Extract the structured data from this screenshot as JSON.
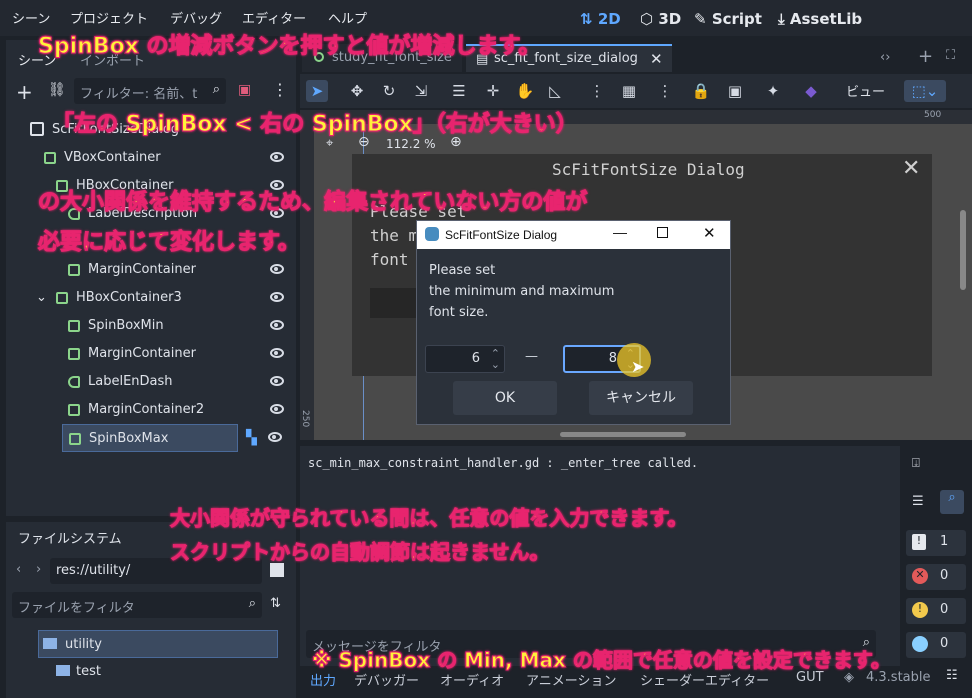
{
  "menu": [
    "シーン",
    "プロジェクト",
    "デバッグ",
    "エディター",
    "ヘルプ"
  ],
  "workspace": [
    {
      "label": "2D",
      "active": true
    },
    {
      "label": "3D"
    },
    {
      "label": "Script"
    },
    {
      "label": "AssetLib"
    }
  ],
  "scene_dock": {
    "tabs": [
      "シーン",
      "インポート"
    ],
    "filter_placeholder": "フィルター: 名前、t",
    "tree": [
      {
        "name": "ScFitFontSizeDialog",
        "indent": 0,
        "icon": "panel"
      },
      {
        "name": "VBoxContainer",
        "indent": 1,
        "icon": "vbox"
      },
      {
        "name": "HBoxContainer",
        "indent": 2,
        "icon": "hbox"
      },
      {
        "name": "LabelDescription",
        "indent": 3,
        "icon": "label"
      },
      {
        "name": "MarginContainer",
        "indent": 2,
        "icon": "margin"
      },
      {
        "name": "HBoxContainer3",
        "indent": 2,
        "icon": "hbox"
      },
      {
        "name": "SpinBoxMin",
        "indent": 3,
        "icon": "spin"
      },
      {
        "name": "MarginContainer",
        "indent": 3,
        "icon": "margin"
      },
      {
        "name": "LabelEnDash",
        "indent": 3,
        "icon": "label"
      },
      {
        "name": "MarginContainer2",
        "indent": 3,
        "icon": "margin"
      },
      {
        "name": "SpinBoxMax",
        "indent": 3,
        "icon": "spin",
        "selected": true
      }
    ]
  },
  "filesystem": {
    "title": "ファイルシステム",
    "path": "res://utility/",
    "filter_placeholder": "ファイルをフィルタ",
    "items": [
      {
        "name": "utility",
        "selected": true
      },
      {
        "name": "test"
      }
    ]
  },
  "editor_tabs": [
    "study_fit_font_size",
    "sc_fit_font_size_dialog"
  ],
  "view_label": "ビュー",
  "zoom": "112.2 %",
  "ruler_marks": [
    "500",
    "250"
  ],
  "game_dialog": {
    "title": "ScFitFontSize Dialog",
    "lines": [
      "Please set",
      "the minimum and maximum",
      "font size."
    ]
  },
  "dialog": {
    "title": "ScFitFontSize Dialog",
    "text": [
      "Please set",
      "the minimum and maximum",
      "font size."
    ],
    "min_value": "6",
    "dash": "—",
    "max_value": "8",
    "ok": "OK",
    "cancel": "キャンセル"
  },
  "output": {
    "line": "sc_min_max_constraint_handler.gd : _enter_tree called.",
    "filter_placeholder": "メッセージをフィルタ",
    "counts": [
      {
        "value": "1",
        "kind": "message",
        "color": "#e6e9ee"
      },
      {
        "value": "0",
        "kind": "error",
        "color": "#e35a5a"
      },
      {
        "value": "0",
        "kind": "warning",
        "color": "#f2c94c"
      },
      {
        "value": "0",
        "kind": "other",
        "color": "#8ad0ff"
      }
    ]
  },
  "bottom_tabs": [
    "出力",
    "デバッガー",
    "オーディオ",
    "アニメーション",
    "シェーダーエディター",
    "GUT"
  ],
  "version": "4.3.stable",
  "annotations": [
    "SpinBox の増減ボタンを押すと値が増減します。",
    "「左の SpinBox < 右の SpinBox」（右が大きい）",
    "の大小関係を維持するため、編集されていない方の値が",
    "必要に応じて変化します。",
    "大小関係が守られている間は、任意の値を入力できます。",
    "スクリプトからの自動調節は起きません。",
    "※ SpinBox の Min, Max の範囲で任意の値を設定できます。"
  ]
}
